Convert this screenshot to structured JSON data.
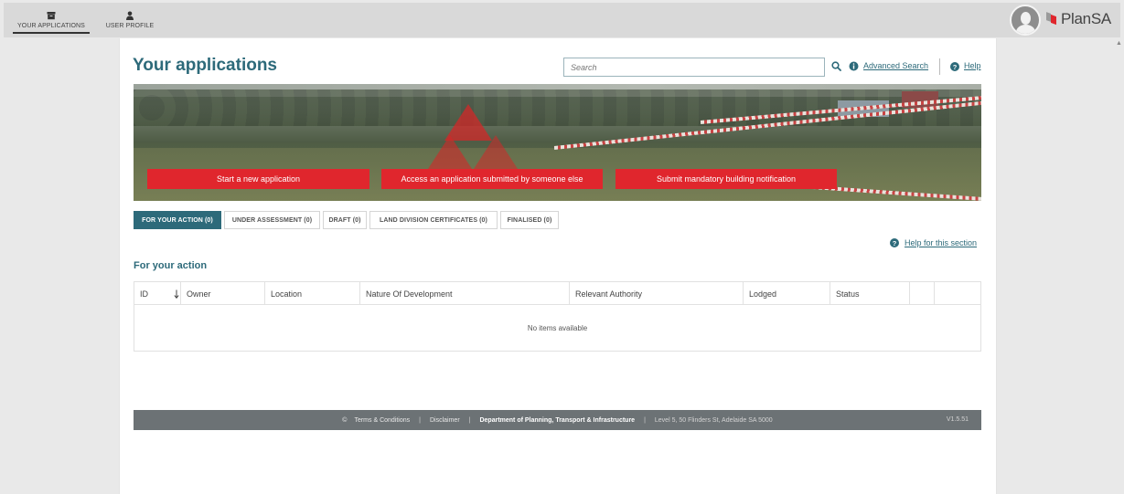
{
  "topnav": {
    "items": [
      {
        "label": "YOUR APPLICATIONS",
        "icon": "archive-box-icon"
      },
      {
        "label": "USER PROFILE",
        "icon": "user-icon"
      }
    ],
    "logo_text": "PlanSA"
  },
  "header": {
    "title": "Your applications",
    "search_placeholder": "Search",
    "advanced_search": "Advanced Search",
    "help": "Help"
  },
  "banner": {
    "buttons": [
      "Start a new application",
      "Access an application submitted by someone else",
      "Submit mandatory building notification"
    ]
  },
  "tabs": [
    {
      "label": "FOR YOUR ACTION (0)",
      "active": true
    },
    {
      "label": "UNDER ASSESSMENT (0)",
      "active": false
    },
    {
      "label": "DRAFT (0)",
      "active": false
    },
    {
      "label": "LAND DIVISION CERTIFICATES (0)",
      "active": false
    },
    {
      "label": "FINALISED (0)",
      "active": false
    }
  ],
  "help_section": "Help for this section",
  "section_title": "For your action",
  "table": {
    "columns": [
      "ID",
      "Owner",
      "Location",
      "Nature Of Development",
      "Relevant Authority",
      "Lodged",
      "Status"
    ],
    "empty_message": "No items available"
  },
  "footer": {
    "copyright": "©",
    "terms": "Terms & Conditions",
    "disclaimer": "Disclaimer",
    "department": "Department of Planning, Transport & Infrastructure",
    "address": "Level 5, 50 Flinders St, Adelaide SA 5000",
    "version": "V1.5.51"
  },
  "colors": {
    "primary": "#2d6a7a",
    "accent_red": "#e0262d",
    "footer_bg": "#6c7275"
  }
}
